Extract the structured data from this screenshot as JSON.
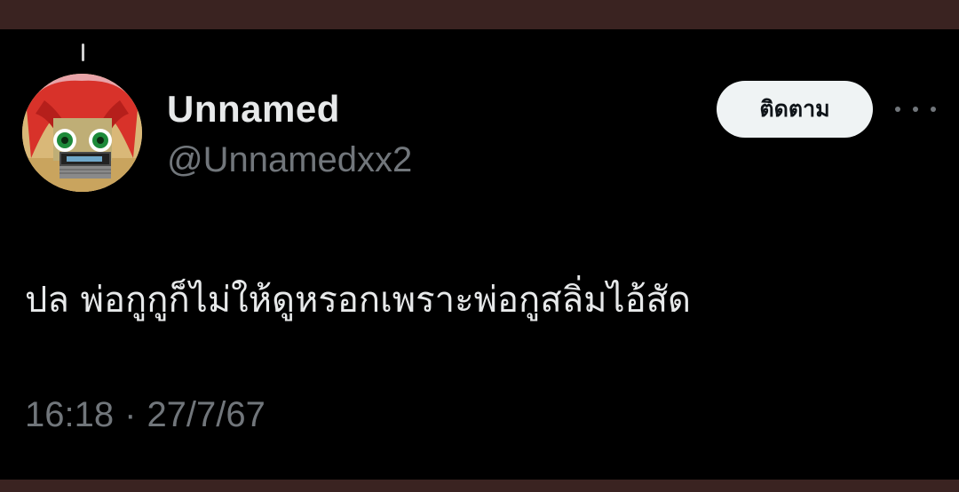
{
  "tweet": {
    "display_name": "Unnamed",
    "handle": "@Unnamedxx2",
    "follow_label": "ติดตาม",
    "text": "ปล พ่อกูกูก็ไม่ให้ดูหรอกเพราะพ่อกูสลิ่มไอ้สัด",
    "time": "16:18",
    "separator": "·",
    "date": "27/7/67"
  },
  "icons": {
    "more": "more-horizontal-icon",
    "avatar": "avatar-image"
  },
  "colors": {
    "background": "#000000",
    "primary_text": "#e7e9ea",
    "secondary_text": "#71767b",
    "follow_button_bg": "#eff3f4",
    "follow_button_text": "#0f1419",
    "frame": "#3a2321"
  }
}
